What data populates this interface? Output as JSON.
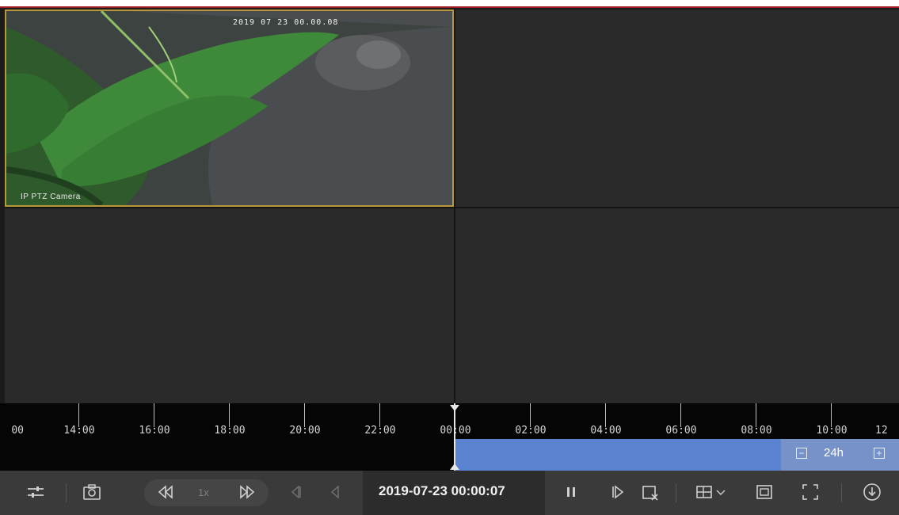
{
  "camera": {
    "osd_timestamp": "2019 07 23 00.00.08",
    "osd_name": "IP PTZ Camera"
  },
  "timeline": {
    "labels": [
      {
        "text": "00"
      },
      {
        "text": "14:00"
      },
      {
        "text": "16:00"
      },
      {
        "text": "18:00"
      },
      {
        "text": "20:00"
      },
      {
        "text": "22:00"
      },
      {
        "text": "00:00"
      },
      {
        "text": "02:00"
      },
      {
        "text": "04:00"
      },
      {
        "text": "06:00"
      },
      {
        "text": "08:00"
      },
      {
        "text": "10:00"
      },
      {
        "text": "12"
      }
    ],
    "zoom_label": "24h",
    "zoom_out": "−",
    "zoom_in": "+"
  },
  "toolbar": {
    "speed": "1x",
    "current_time": "2019-07-23 00:00:07"
  },
  "colors": {
    "selected_border": "#b8983a",
    "recording_bar": "#5b83d1",
    "accent_red": "#a01f26"
  },
  "icons": [
    "settings-sliders-icon",
    "camera-snapshot-icon",
    "rewind-icon",
    "fast-forward-icon",
    "frame-back-icon",
    "step-back-icon",
    "pause-icon",
    "step-forward-icon",
    "clip-icon",
    "layout-grid-icon",
    "window-icon",
    "fullscreen-icon",
    "download-icon"
  ]
}
